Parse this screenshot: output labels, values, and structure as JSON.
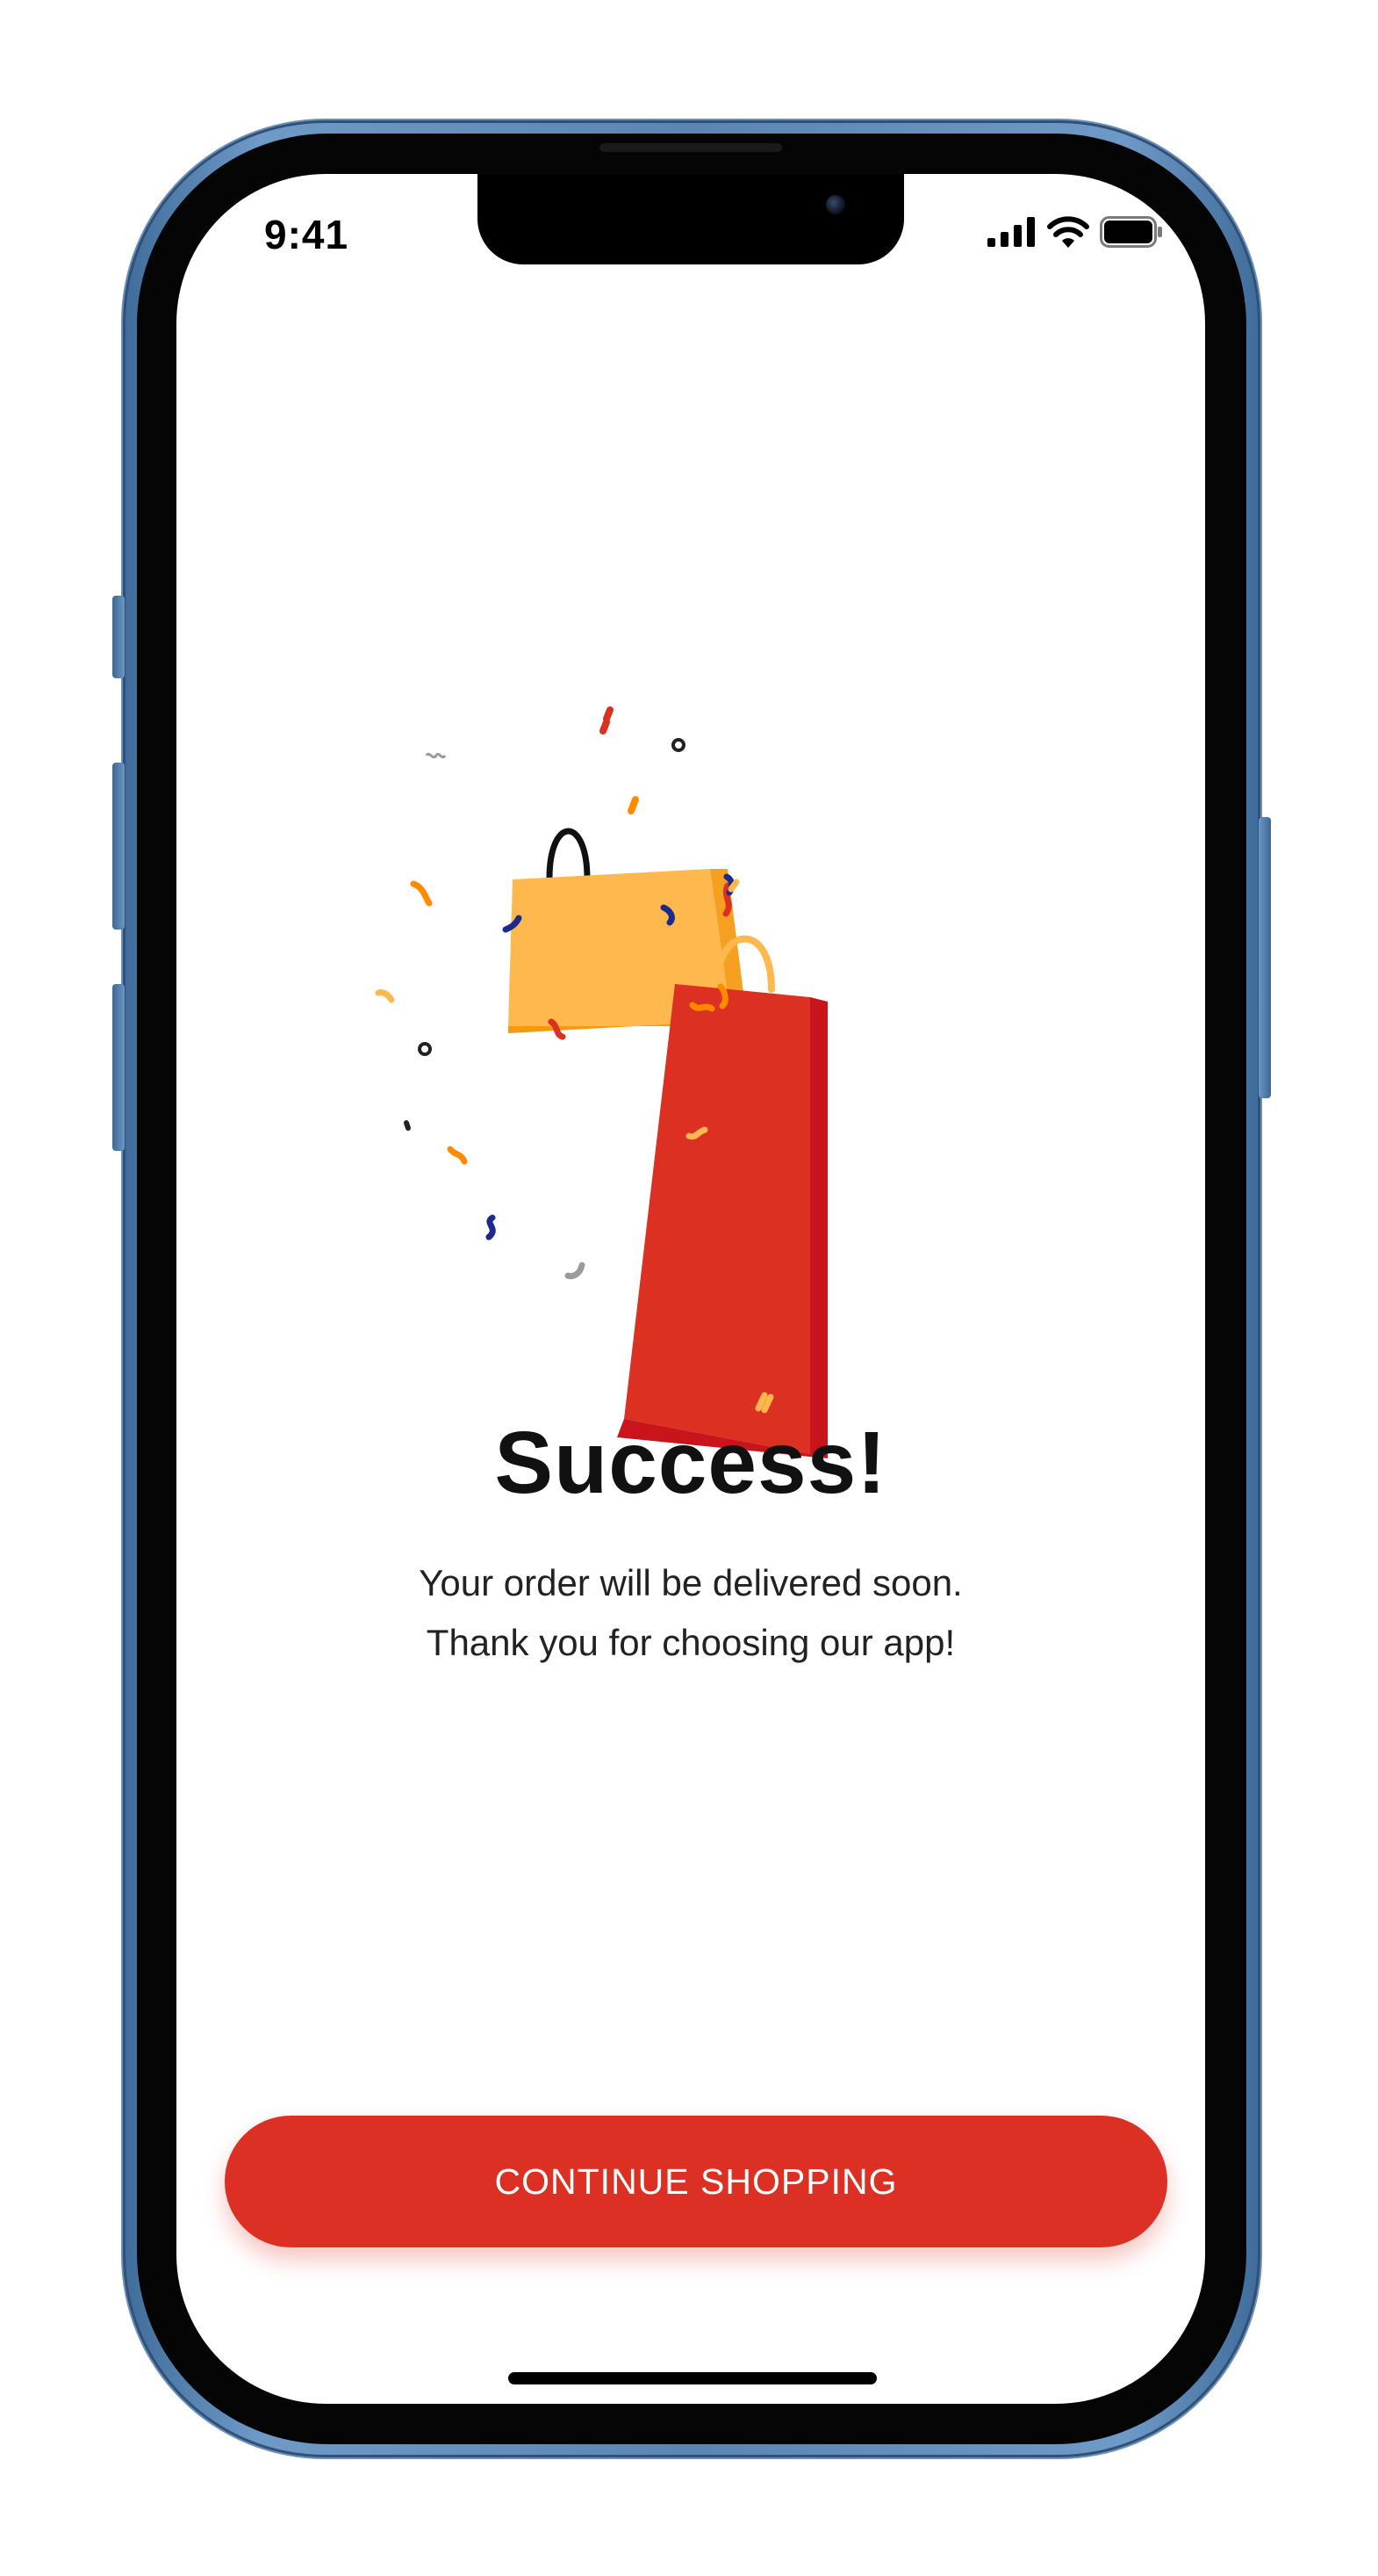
{
  "status_bar": {
    "time": "9:41",
    "signal_icon": "cellular-signal-icon",
    "wifi_icon": "wifi-icon",
    "battery_icon": "battery-icon"
  },
  "illustration": {
    "icon": "shopping-bags-confetti-illustration",
    "colors": {
      "yellow_bag": "#FFB84D",
      "red_bag": "#DB3022",
      "confetti": [
        "#DB3022",
        "#FF8A00",
        "#FFB84D",
        "#1C2A8C",
        "#222222",
        "#9B9B9B"
      ]
    }
  },
  "message": {
    "title": "Success!",
    "line1": "Your order will be delivered soon.",
    "line2": "Thank you for choosing our app!"
  },
  "actions": {
    "continue_label": "CONTINUE SHOPPING"
  },
  "colors": {
    "accent": "#DB3022",
    "frame": "#5A86B4"
  }
}
